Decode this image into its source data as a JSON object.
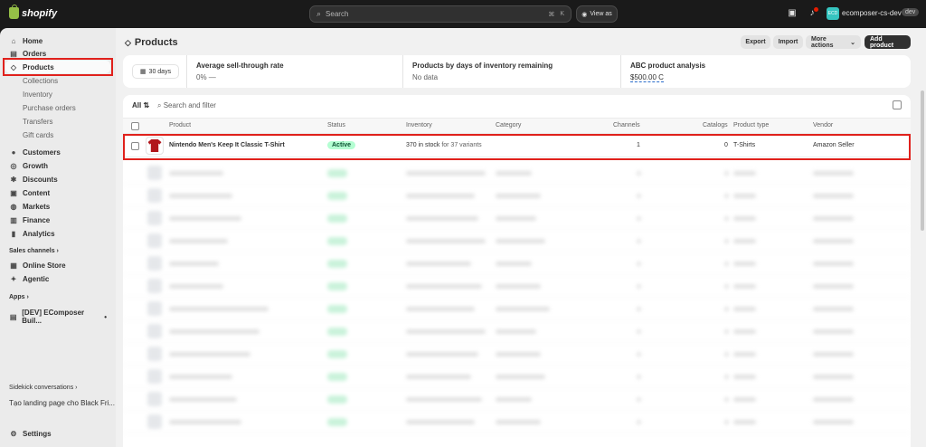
{
  "topbar": {
    "logo_text": "shopify",
    "search_placeholder": "Search",
    "search_shortcut_1": "⌘",
    "search_shortcut_2": "K",
    "view_as_label": "View as",
    "store_initials": "ECD",
    "store_name": "ecomposer-cs-dev",
    "store_badge": "dev"
  },
  "sidebar": {
    "items": [
      {
        "label": "Home",
        "icon": "home-icon",
        "glyph": "⌂"
      },
      {
        "label": "Orders",
        "icon": "orders-icon",
        "glyph": "▤"
      },
      {
        "label": "Products",
        "icon": "tag-icon",
        "glyph": "◇"
      }
    ],
    "product_subitems": [
      "Collections",
      "Inventory",
      "Purchase orders",
      "Transfers",
      "Gift cards"
    ],
    "items2": [
      {
        "label": "Customers",
        "icon": "customers-icon",
        "glyph": "●"
      },
      {
        "label": "Growth",
        "icon": "growth-icon",
        "glyph": "◎"
      },
      {
        "label": "Discounts",
        "icon": "discounts-icon",
        "glyph": "✱"
      },
      {
        "label": "Content",
        "icon": "content-icon",
        "glyph": "▣"
      },
      {
        "label": "Markets",
        "icon": "markets-icon",
        "glyph": "◍"
      },
      {
        "label": "Finance",
        "icon": "finance-icon",
        "glyph": "▥"
      },
      {
        "label": "Analytics",
        "icon": "analytics-icon",
        "glyph": "▮"
      }
    ],
    "sales_channels_label": "Sales channels",
    "channels": [
      {
        "label": "Online Store",
        "icon": "store-icon",
        "glyph": "▦"
      },
      {
        "label": "Agentic",
        "icon": "agentic-icon",
        "glyph": "✦"
      }
    ],
    "apps_label": "Apps",
    "app_item": "[DEV] EComposer Buil...",
    "sidekick_label": "Sidekick conversations",
    "sidekick_item": "Tạo landing page cho Black Fri...",
    "settings_label": "Settings"
  },
  "page": {
    "title": "Products",
    "buttons": {
      "export": "Export",
      "import": "Import",
      "more_actions": "More actions",
      "add_product": "Add product"
    }
  },
  "analytics": {
    "period": "30 days",
    "metrics": [
      {
        "title": "Average sell-through rate",
        "value": "0% —"
      },
      {
        "title": "Products by days of inventory remaining",
        "value": "No data"
      },
      {
        "title": "ABC product analysis",
        "value": "$500.00 C"
      }
    ]
  },
  "table": {
    "filter_tab": "All",
    "search_placeholder": "Search and filter",
    "headers": [
      "Product",
      "Status",
      "Inventory",
      "Category",
      "Channels",
      "Catalogs",
      "Product type",
      "Vendor"
    ],
    "first_row": {
      "product": "Nintendo Men's Keep It Classic T-Shirt",
      "status": "Active",
      "inventory": "370 in stock",
      "variants": "for 37 variants",
      "category": "",
      "channels": "1",
      "catalogs": "0",
      "product_type": "T-Shirts",
      "vendor": "Amazon Seller"
    }
  },
  "colors": {
    "accent": "#303030",
    "active_status": "#b4fed2",
    "highlight_box": "#e0211c"
  }
}
